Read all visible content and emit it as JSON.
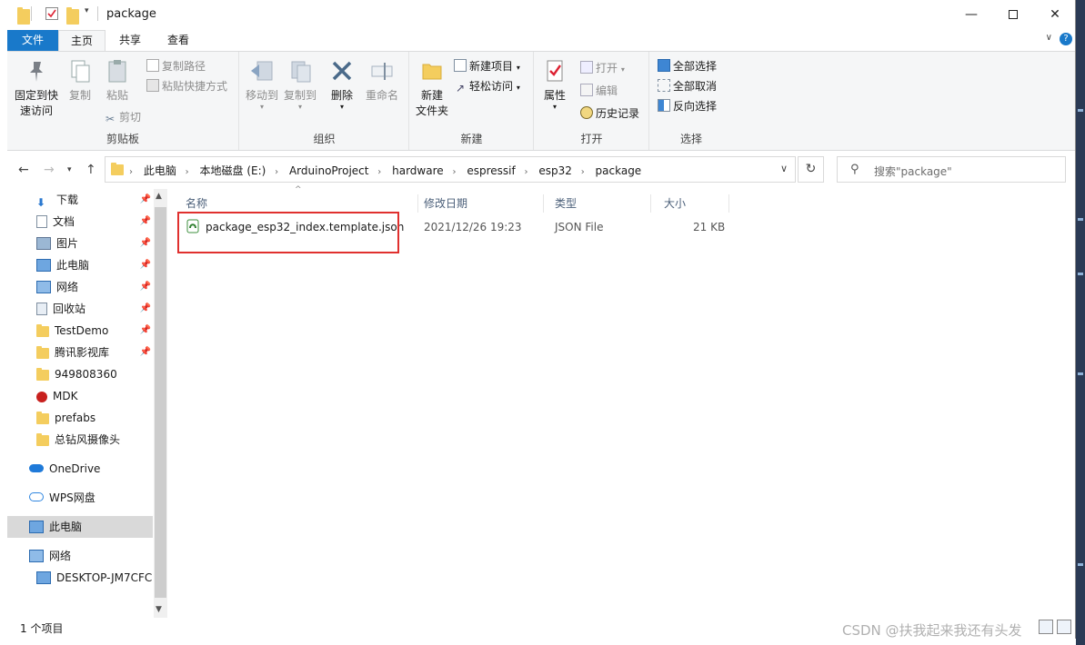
{
  "window": {
    "title": "package"
  },
  "tabs": {
    "file": "文件",
    "home": "主页",
    "share": "共享",
    "view": "查看",
    "help": "?"
  },
  "ribbon": {
    "clipboard": {
      "label": "剪贴板",
      "pin": "固定到快\n速访问",
      "pin_l1": "固定到快",
      "pin_l2": "速访问",
      "copy": "复制",
      "paste": "粘贴",
      "copy_path": "复制路径",
      "paste_shortcut": "粘贴快捷方式",
      "cut": "剪切"
    },
    "organize": {
      "label": "组织",
      "move_to": "移动到",
      "copy_to": "复制到",
      "delete": "删除",
      "rename": "重命名"
    },
    "new": {
      "label": "新建",
      "new_folder_l1": "新建",
      "new_folder_l2": "文件夹",
      "new_item": "新建项目",
      "easy_access": "轻松访问"
    },
    "open": {
      "label": "打开",
      "properties": "属性",
      "open": "打开",
      "edit": "编辑",
      "history": "历史记录"
    },
    "select": {
      "label": "选择",
      "select_all": "全部选择",
      "select_none": "全部取消",
      "invert": "反向选择"
    }
  },
  "address": {
    "crumbs": [
      "此电脑",
      "本地磁盘 (E:)",
      "ArduinoProject",
      "hardware",
      "espressif",
      "esp32",
      "package"
    ],
    "search_placeholder": "搜索\"package\""
  },
  "nav": {
    "quick": [
      {
        "label": "下载",
        "icon": "download-icon"
      },
      {
        "label": "文档",
        "icon": "document-icon"
      },
      {
        "label": "图片",
        "icon": "picture-icon"
      },
      {
        "label": "此电脑",
        "icon": "computer-icon"
      },
      {
        "label": "网络",
        "icon": "network-icon"
      },
      {
        "label": "回收站",
        "icon": "recycle-bin-icon"
      },
      {
        "label": "TestDemo",
        "icon": "folder-icon"
      },
      {
        "label": "腾讯影视库",
        "icon": "folder-icon"
      },
      {
        "label": "949808360",
        "icon": "folder-icon"
      },
      {
        "label": "MDK",
        "icon": "mdk-icon"
      },
      {
        "label": "prefabs",
        "icon": "folder-icon"
      },
      {
        "label": "总钻风摄像头",
        "icon": "folder-icon"
      }
    ],
    "onedrive": "OneDrive",
    "wps": "WPS网盘",
    "this_pc": "此电脑",
    "network": "网络",
    "desktop": "DESKTOP-JM7CFC"
  },
  "columns": {
    "name": "名称",
    "date": "修改日期",
    "type": "类型",
    "size": "大小"
  },
  "files": [
    {
      "name": "package_esp32_index.template.json",
      "date": "2021/12/26 19:23",
      "type": "JSON File",
      "size": "21 KB"
    }
  ],
  "status": {
    "count": "1 个项目"
  },
  "watermark": "CSDN @扶我起来我还有头发",
  "colors": {
    "accent": "#1979ca",
    "highlight": "#e0302e",
    "folder": "#f4cd5e"
  }
}
